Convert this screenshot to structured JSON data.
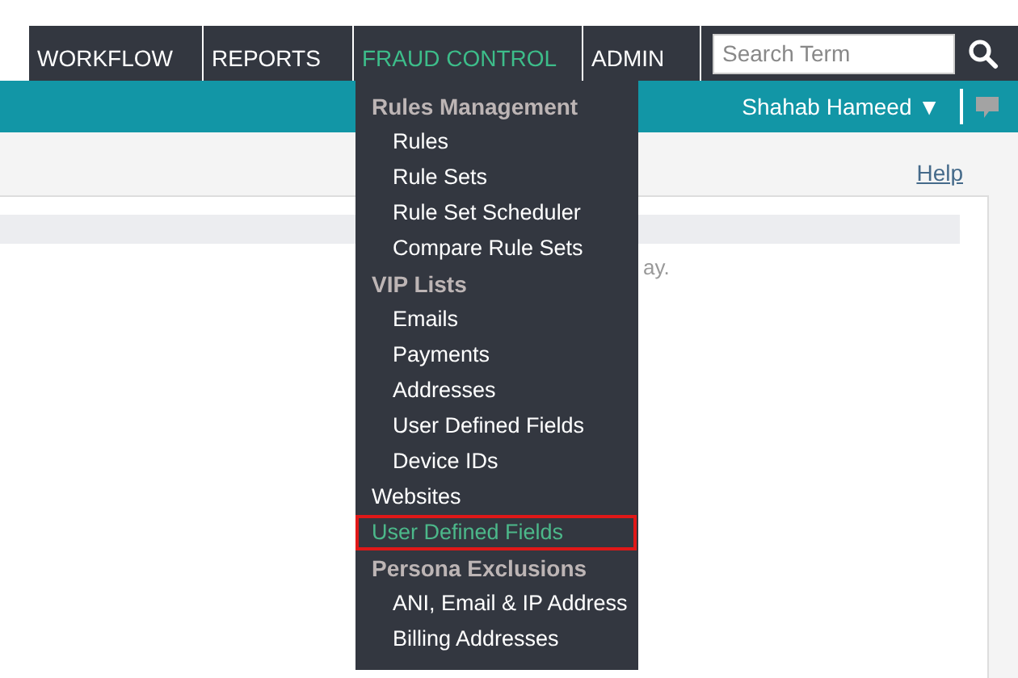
{
  "nav_tabs": [
    {
      "label": "WORKFLOW",
      "selected": false
    },
    {
      "label": "REPORTS",
      "selected": false
    },
    {
      "label": "FRAUD CONTROL",
      "selected": true
    },
    {
      "label": "ADMIN",
      "selected": false
    }
  ],
  "search": {
    "placeholder": "Search Term"
  },
  "user_menu": {
    "label": "Shahab Hameed",
    "caret": "▼"
  },
  "help_link": "Help",
  "content_fragment": "ay.",
  "fraud_menu": [
    {
      "label": "Rules Management",
      "kind": "header",
      "children": [
        {
          "label": "Rules",
          "selected": false
        },
        {
          "label": "Rule Sets",
          "selected": false
        },
        {
          "label": "Rule Set Scheduler",
          "selected": false
        },
        {
          "label": "Compare Rule Sets",
          "selected": false
        }
      ]
    },
    {
      "label": "VIP Lists",
      "kind": "header",
      "children": [
        {
          "label": "Emails",
          "selected": false
        },
        {
          "label": "Payments",
          "selected": false
        },
        {
          "label": "Addresses",
          "selected": false
        },
        {
          "label": "User Defined Fields",
          "selected": false
        },
        {
          "label": "Device IDs",
          "selected": false
        }
      ]
    },
    {
      "label": "Websites",
      "kind": "link",
      "selected": false
    },
    {
      "label": "User Defined Fields",
      "kind": "link",
      "selected": true
    },
    {
      "label": "Persona Exclusions",
      "kind": "header",
      "children": [
        {
          "label": "ANI, Email & IP Address",
          "selected": false
        },
        {
          "label": "Billing Addresses",
          "selected": false
        }
      ]
    }
  ]
}
